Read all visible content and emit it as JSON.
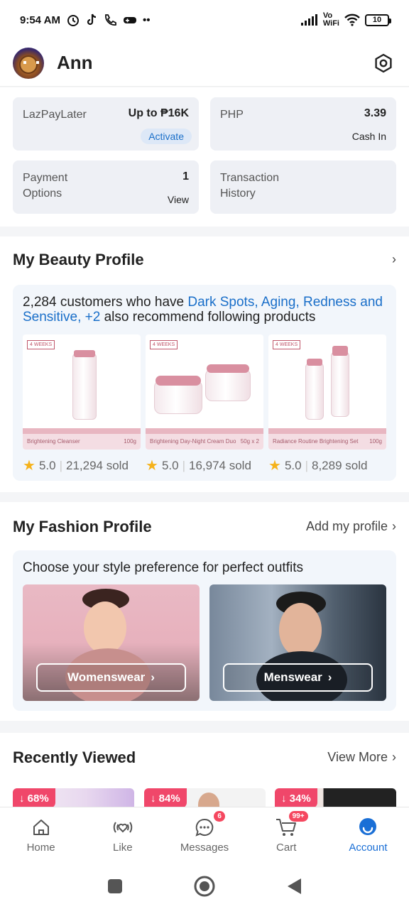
{
  "status_bar": {
    "time": "9:54 AM",
    "vo_line1": "Vo",
    "vo_line2": "WiFi",
    "battery": "10"
  },
  "header": {
    "username": "Ann"
  },
  "wallet": {
    "lazpaylater_label": "LazPayLater",
    "lazpaylater_value": "Up to ₱16K",
    "lazpaylater_action": "Activate",
    "php_label": "PHP",
    "php_value": "3.39",
    "php_action": "Cash In",
    "payment_label_1": "Payment",
    "payment_label_2": "Options",
    "payment_count": "1",
    "payment_action": "View",
    "transaction_label_1": "Transaction",
    "transaction_label_2": "History"
  },
  "beauty": {
    "title": "My Beauty Profile",
    "text_start": "2,284 customers who have ",
    "text_highlight": "Dark Spots, Aging, Redness and Sensitive, +2",
    "text_end": " also recommend following products",
    "products": [
      {
        "tag": "4 WEEKS",
        "bar": "Brightening Cleanser",
        "size": "100g",
        "rating": "5.0",
        "sold": "21,294 sold"
      },
      {
        "tag": "4 WEEKS",
        "bar": "Brightening Day-Night Cream Duo",
        "size": "50g x 2",
        "rating": "5.0",
        "sold": "16,974 sold"
      },
      {
        "tag": "4 WEEKS",
        "bar": "Radiance Routine Brightening Set",
        "size": "100g",
        "rating": "5.0",
        "sold": "8,289 sold"
      }
    ]
  },
  "fashion": {
    "title": "My Fashion Profile",
    "link": "Add my profile",
    "prompt": "Choose your style preference for perfect outfits",
    "womenswear": "Womenswear",
    "menswear": "Menswear"
  },
  "recent": {
    "title": "Recently Viewed",
    "link": "View More",
    "items": [
      {
        "discount": "68%"
      },
      {
        "discount": "84%"
      },
      {
        "discount": "34%"
      }
    ]
  },
  "bottom_nav": {
    "home": "Home",
    "like": "Like",
    "messages": "Messages",
    "messages_badge": "6",
    "cart": "Cart",
    "cart_badge": "99+",
    "account": "Account"
  },
  "colors": {
    "accent": "#1a6fd6",
    "link_blue": "#1a6fc9",
    "discount_red": "#f0476a",
    "star": "#f5b21b"
  }
}
